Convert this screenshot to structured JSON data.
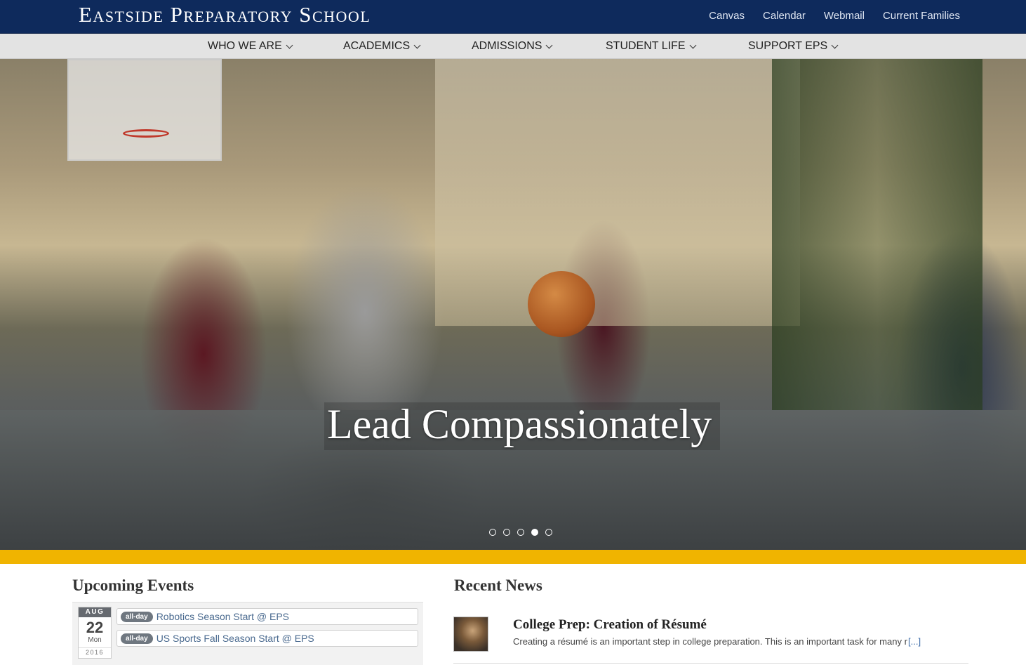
{
  "header": {
    "logo": "Eastside Preparatory School",
    "utility_links": [
      "Canvas",
      "Calendar",
      "Webmail",
      "Current Families"
    ],
    "bg_color": "#0e2a5c"
  },
  "nav": {
    "items": [
      "WHO WE ARE",
      "ACADEMICS",
      "ADMISSIONS",
      "STUDENT LIFE",
      "SUPPORT EPS"
    ]
  },
  "hero": {
    "caption": "Lead Compassionately",
    "slides_total": 5,
    "active_slide": 4,
    "accent_color": "#f0b400"
  },
  "events": {
    "heading": "Upcoming Events",
    "date": {
      "month": "AUG",
      "day": "22",
      "weekday": "Mon",
      "year": "2016"
    },
    "items": [
      {
        "badge": "all-day",
        "title": "Robotics Season Start @ EPS"
      },
      {
        "badge": "all-day",
        "title": "US Sports Fall Season Start @ EPS"
      }
    ]
  },
  "news": {
    "heading": "Recent News",
    "items": [
      {
        "title": "College Prep: Creation of Résumé",
        "excerpt": "Creating a résumé is an important step in college preparation. This is an important task for many re",
        "more": "[...]"
      }
    ]
  }
}
